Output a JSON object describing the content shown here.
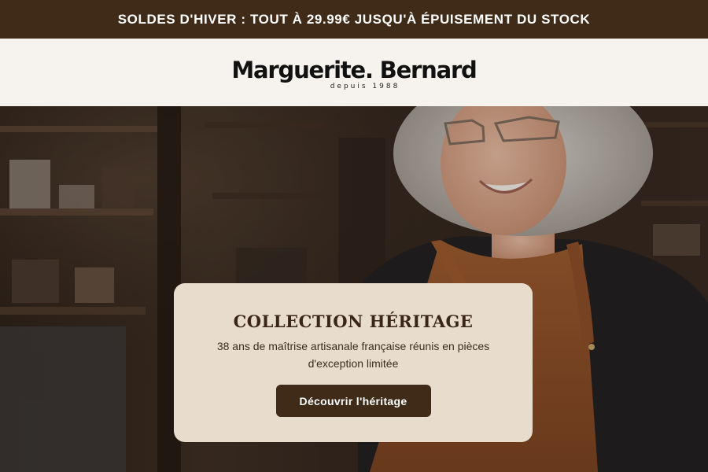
{
  "promo": {
    "text": "SOLDES D'HIVER : TOUT À 29.99€ JUSQU'À ÉPUISEMENT DU STOCK"
  },
  "brand": {
    "name": "Marguerite. Bernard",
    "tagline": "depuis 1988"
  },
  "hero": {
    "image": "portrait of smiling elderly woman with curly grey hair, glasses and leather apron in a workshop",
    "title": "COLLECTION HÉRITAGE",
    "subtitle": "38 ans de maîtrise artisanale française réunis en pièces d'exception limitée",
    "cta_label": "Découvrir l'héritage"
  },
  "colors": {
    "promo_bg": "#3f2b17",
    "header_bg": "#f6f2ee",
    "card_bg": "#e8dccd",
    "button_bg": "#3f2b17",
    "apron": "#8a4d26"
  }
}
